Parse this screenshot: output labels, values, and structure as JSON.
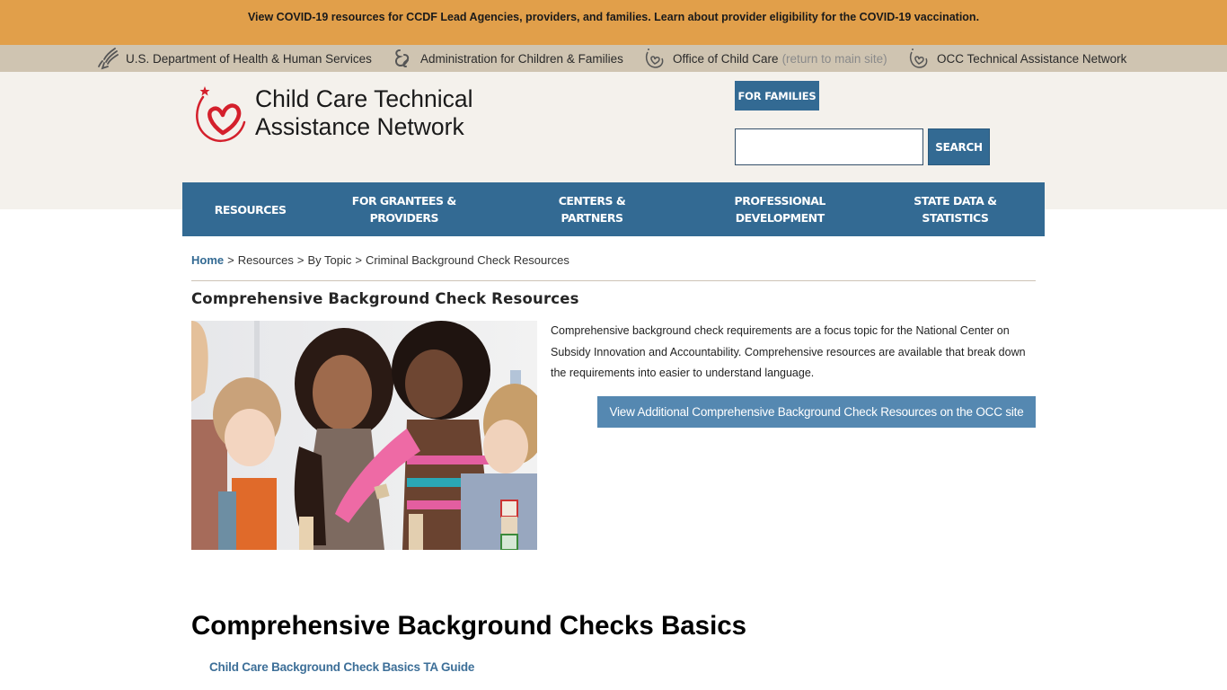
{
  "alert": {
    "text": "View COVID-19 resources for CCDF Lead Agencies, providers, and families. Learn about provider eligibility for the COVID-19 vaccination."
  },
  "agency_bar": {
    "items": [
      {
        "label": "U.S. Department of Health & Human Services",
        "icon": "hhs-eagle-icon"
      },
      {
        "label": "Administration for Children & Families",
        "icon": "acf-logo-icon"
      },
      {
        "label": "Office of Child Care",
        "suffix": "(return to main site)",
        "icon": "occ-heart-icon"
      },
      {
        "label": "OCC Technical Assistance Network",
        "icon": "occ-heart-icon"
      }
    ]
  },
  "header": {
    "logo_line1": "Child Care Technical",
    "logo_line2": "Assistance Network",
    "for_families_label": "FOR FAMILIES",
    "search": {
      "value": "",
      "placeholder": "",
      "button_label": "SEARCH"
    }
  },
  "nav": {
    "items": [
      {
        "label": "RESOURCES"
      },
      {
        "label": "FOR GRANTEES & PROVIDERS"
      },
      {
        "label": "CENTERS & PARTNERS"
      },
      {
        "label": "PROFESSIONAL DEVELOPMENT"
      },
      {
        "label": "STATE DATA & STATISTICS"
      }
    ]
  },
  "breadcrumb": {
    "items": [
      "Home",
      "Resources",
      "By Topic",
      "Criminal Background Check Resources"
    ],
    "separator": ">"
  },
  "content": {
    "section_title": "Comprehensive Background Check Resources",
    "image_alt": "Teacher with children playing with alphabet blocks",
    "intro": "Comprehensive background check requirements are a focus topic for the National Center on Subsidy Innovation and Accountability. Comprehensive resources are available that break down the requirements into easier to understand language.",
    "occ_button_label": "View Additional Comprehensive Background Check Resources on the OCC site",
    "basics_heading": "Comprehensive Background Checks Basics",
    "guide_link": "Child Care Background Check Basics TA Guide"
  },
  "colors": {
    "alert_bg": "#e19f4a",
    "agency_bar_bg": "#cfc4b1",
    "header_bg": "#f4f1ec",
    "primary_blue": "#336a93",
    "button_blue": "#5588b1",
    "logo_red": "#d4202c"
  }
}
